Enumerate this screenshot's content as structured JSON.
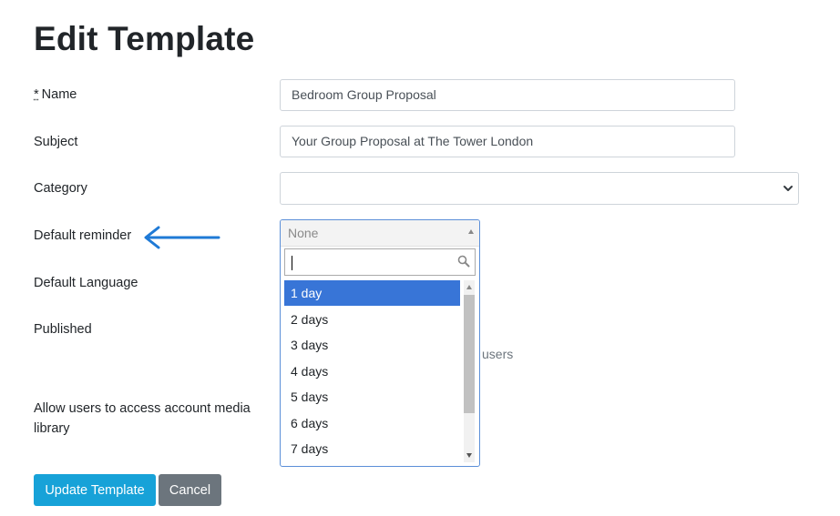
{
  "page": {
    "title": "Edit Template"
  },
  "form": {
    "name": {
      "required_mark": "*",
      "label": "Name",
      "value": "Bedroom Group Proposal"
    },
    "subject": {
      "label": "Subject",
      "value": "Your Group Proposal at The Tower London"
    },
    "category": {
      "label": "Category",
      "value": ""
    },
    "default_reminder": {
      "label": "Default reminder",
      "selected": "None",
      "search_value": "",
      "options": [
        "1 day",
        "2 days",
        "3 days",
        "4 days",
        "5 days",
        "6 days",
        "7 days"
      ],
      "highlighted_option": "1 day"
    },
    "default_language": {
      "label": "Default Language"
    },
    "published": {
      "label": "Published",
      "hint_partial": "users"
    },
    "media_library": {
      "label_line1": "Allow users to access account media",
      "label_line2": "library"
    }
  },
  "actions": {
    "update_label": "Update Template",
    "cancel_label": "Cancel"
  },
  "annotations": {
    "arrow_color": "#1f7ad6",
    "arrow_icon": "arrow-left-icon"
  },
  "colors": {
    "primary": "#17a2d8",
    "secondary": "#6c757d",
    "highlight": "#3875d7"
  }
}
